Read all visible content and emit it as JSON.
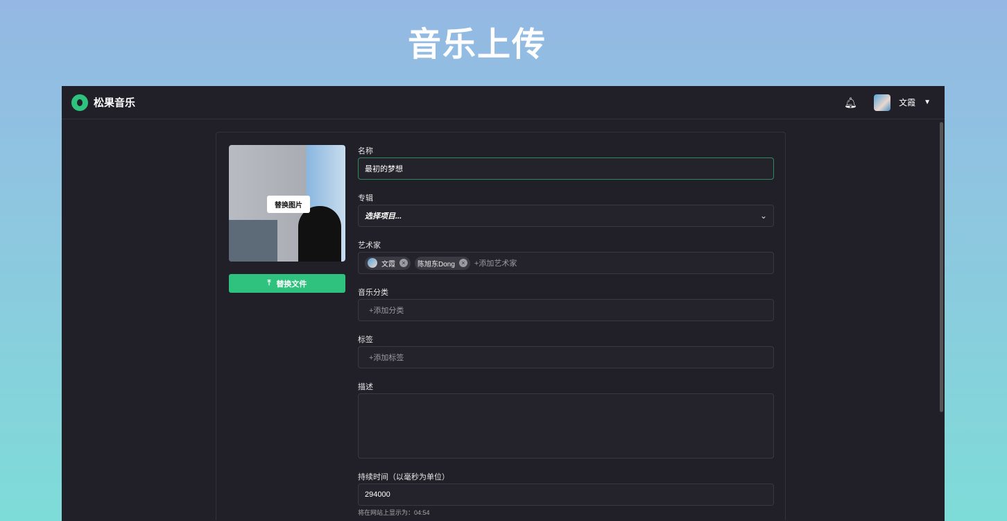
{
  "page_title": "音乐上传",
  "header": {
    "brand": "松果音乐",
    "user_name": "文霞"
  },
  "cover": {
    "replace_image_label": "替换图片",
    "replace_file_label": "替换文件"
  },
  "form": {
    "name": {
      "label": "名称",
      "value": "最初的梦想"
    },
    "album": {
      "label": "专辑",
      "value": "选择项目..."
    },
    "artists": {
      "label": "艺术家",
      "chips": [
        "文霞",
        "陈旭东Dong"
      ],
      "placeholder": "+添加艺术家"
    },
    "genre": {
      "label": "音乐分类",
      "placeholder": "+添加分类"
    },
    "tags": {
      "label": "标签",
      "placeholder": "+添加标签"
    },
    "description": {
      "label": "描述",
      "value": ""
    },
    "duration": {
      "label": "持续时间（以毫秒为单位）",
      "value": "294000",
      "hint": "将在网站上显示为：04:54"
    }
  }
}
